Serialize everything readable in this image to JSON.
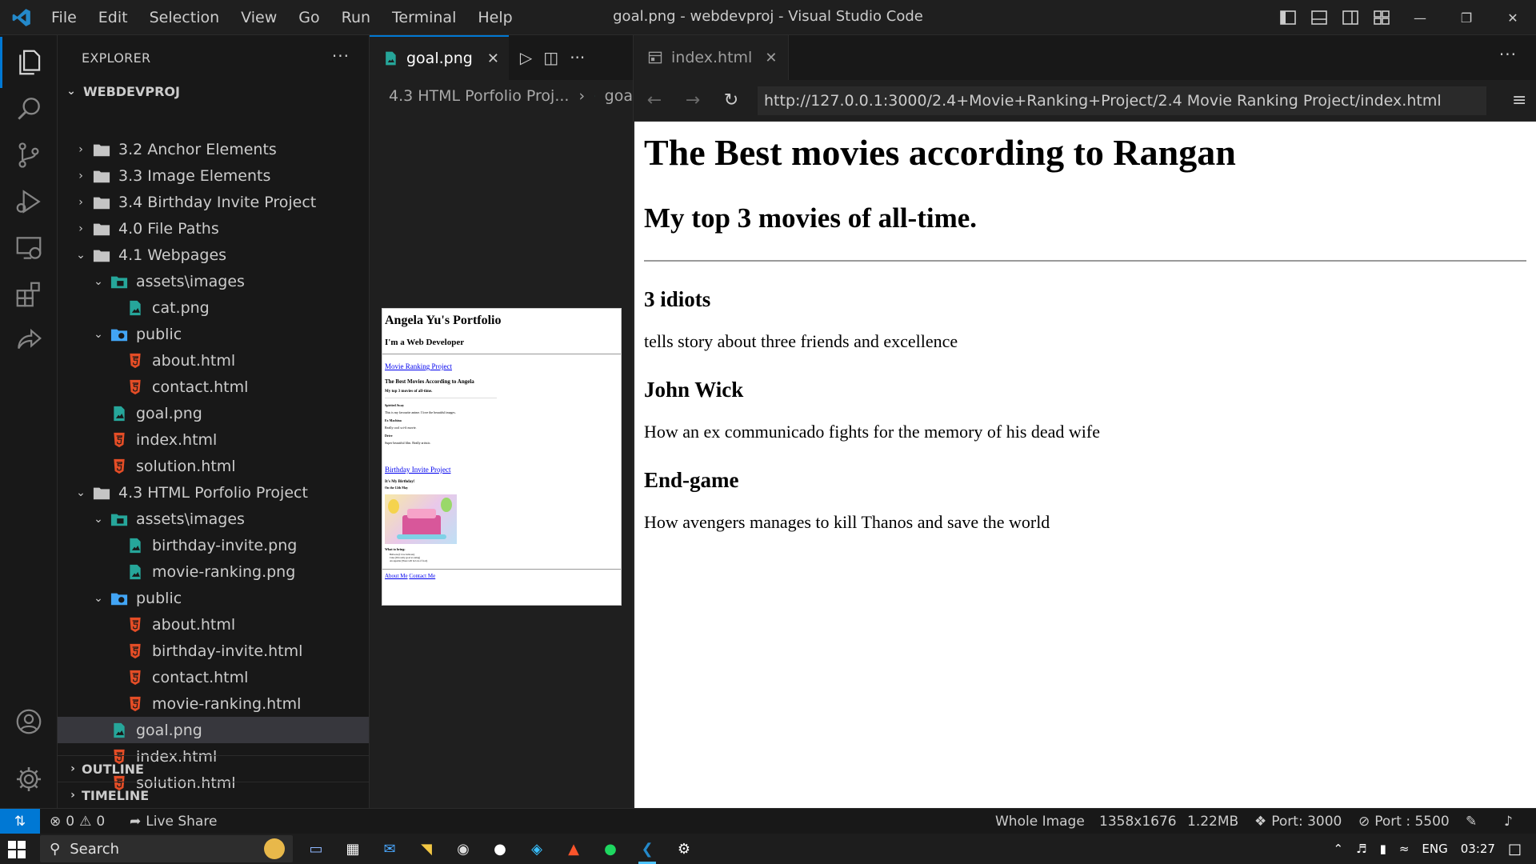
{
  "window": {
    "title": "goal.png - webdevproj - Visual Studio Code",
    "menu": [
      "File",
      "Edit",
      "Selection",
      "View",
      "Go",
      "Run",
      "Terminal",
      "Help"
    ]
  },
  "sidebar": {
    "header": "EXPLORER",
    "more": "···",
    "root": "WEBDEVPROJ",
    "tree": [
      {
        "label": "3.2 Anchor Elements",
        "type": "folder",
        "depth": 1,
        "open": false
      },
      {
        "label": "3.3 Image Elements",
        "type": "folder",
        "depth": 1,
        "open": false
      },
      {
        "label": "3.4 Birthday Invite Project",
        "type": "folder",
        "depth": 1,
        "open": false
      },
      {
        "label": "4.0 File Paths",
        "type": "folder",
        "depth": 1,
        "open": false
      },
      {
        "label": "4.1 Webpages",
        "type": "folder",
        "depth": 1,
        "open": true
      },
      {
        "label": "assets\\images",
        "type": "folder-img",
        "depth": 2,
        "open": true
      },
      {
        "label": "cat.png",
        "type": "image",
        "depth": 3
      },
      {
        "label": "public",
        "type": "folder-public",
        "depth": 2,
        "open": true
      },
      {
        "label": "about.html",
        "type": "html",
        "depth": 3
      },
      {
        "label": "contact.html",
        "type": "html",
        "depth": 3
      },
      {
        "label": "goal.png",
        "type": "image",
        "depth": 2
      },
      {
        "label": "index.html",
        "type": "html",
        "depth": 2
      },
      {
        "label": "solution.html",
        "type": "html",
        "depth": 2
      },
      {
        "label": "4.3 HTML Porfolio Project",
        "type": "folder",
        "depth": 1,
        "open": true
      },
      {
        "label": "assets\\images",
        "type": "folder-img",
        "depth": 2,
        "open": true
      },
      {
        "label": "birthday-invite.png",
        "type": "image",
        "depth": 3
      },
      {
        "label": "movie-ranking.png",
        "type": "image",
        "depth": 3
      },
      {
        "label": "public",
        "type": "folder-public",
        "depth": 2,
        "open": true
      },
      {
        "label": "about.html",
        "type": "html",
        "depth": 3
      },
      {
        "label": "birthday-invite.html",
        "type": "html",
        "depth": 3
      },
      {
        "label": "contact.html",
        "type": "html",
        "depth": 3
      },
      {
        "label": "movie-ranking.html",
        "type": "html",
        "depth": 3
      },
      {
        "label": "goal.png",
        "type": "image",
        "depth": 2,
        "selected": true
      },
      {
        "label": "index.html",
        "type": "html",
        "depth": 2
      },
      {
        "label": "solution.html",
        "type": "html",
        "depth": 2
      }
    ],
    "outline": "OUTLINE",
    "timeline": "TIMELINE"
  },
  "editor1": {
    "tab": "goal.png",
    "breadcrumb": [
      "4.3 HTML Porfolio Proj...",
      "goa"
    ],
    "preview": {
      "title": "Angela Yu's Portfolio",
      "subtitle": "I'm a Web Developer",
      "link1": "Movie Ranking Project",
      "movie_title": "The Best Movies According to Angela",
      "movie_sub": "My top 3 movies of all-time.",
      "m1": "Spirited Away",
      "m1d": "This is my favourite anime. I love the beautiful images.",
      "m2": "Ex Machina",
      "m2d": "Really cool sci-fi movie.",
      "m3": "Drive",
      "m3d": "Super beautiful film. Really artistic.",
      "link2": "Birthday Invite Project",
      "bday_title": "It's My Birthday!",
      "bday_sub": "On the 12th May",
      "bring": "What to bring:",
      "bring_items": [
        "Balloons (I love balloons)",
        "Cake (I'm really good at eating)",
        "An appetite (There will be lots of food)"
      ],
      "footer_links": [
        "About Me",
        "Contact Me"
      ]
    }
  },
  "editor2": {
    "tab": "index.html",
    "url": "http://127.0.0.1:3000/2.4+Movie+Ranking+Project/2.4 Movie Ranking Project/index.html",
    "page": {
      "h1": "The Best movies according to Rangan",
      "h2": "My top 3 movies of all-time.",
      "movies": [
        {
          "title": "3 idiots",
          "desc": "tells story about three friends and excellence"
        },
        {
          "title": "John Wick",
          "desc": "How an ex communicado fights for the memory of his dead wife"
        },
        {
          "title": "End-game",
          "desc": "How avengers manages to kill Thanos and save the world"
        }
      ]
    }
  },
  "status": {
    "errors": "0",
    "warnings": "0",
    "live_share": "Live Share",
    "zoom": "Whole Image",
    "dimensions": "1358x1676",
    "size": "1.22MB",
    "port1": "Port: 3000",
    "port2": "Port : 5500"
  },
  "taskbar": {
    "search": "Search",
    "lang": "ENG",
    "time": "03:27"
  },
  "colors": {
    "accent": "#0078d4",
    "html_icon": "#e44d26",
    "image_icon": "#26a69a",
    "folder": "#c5c5c5"
  }
}
